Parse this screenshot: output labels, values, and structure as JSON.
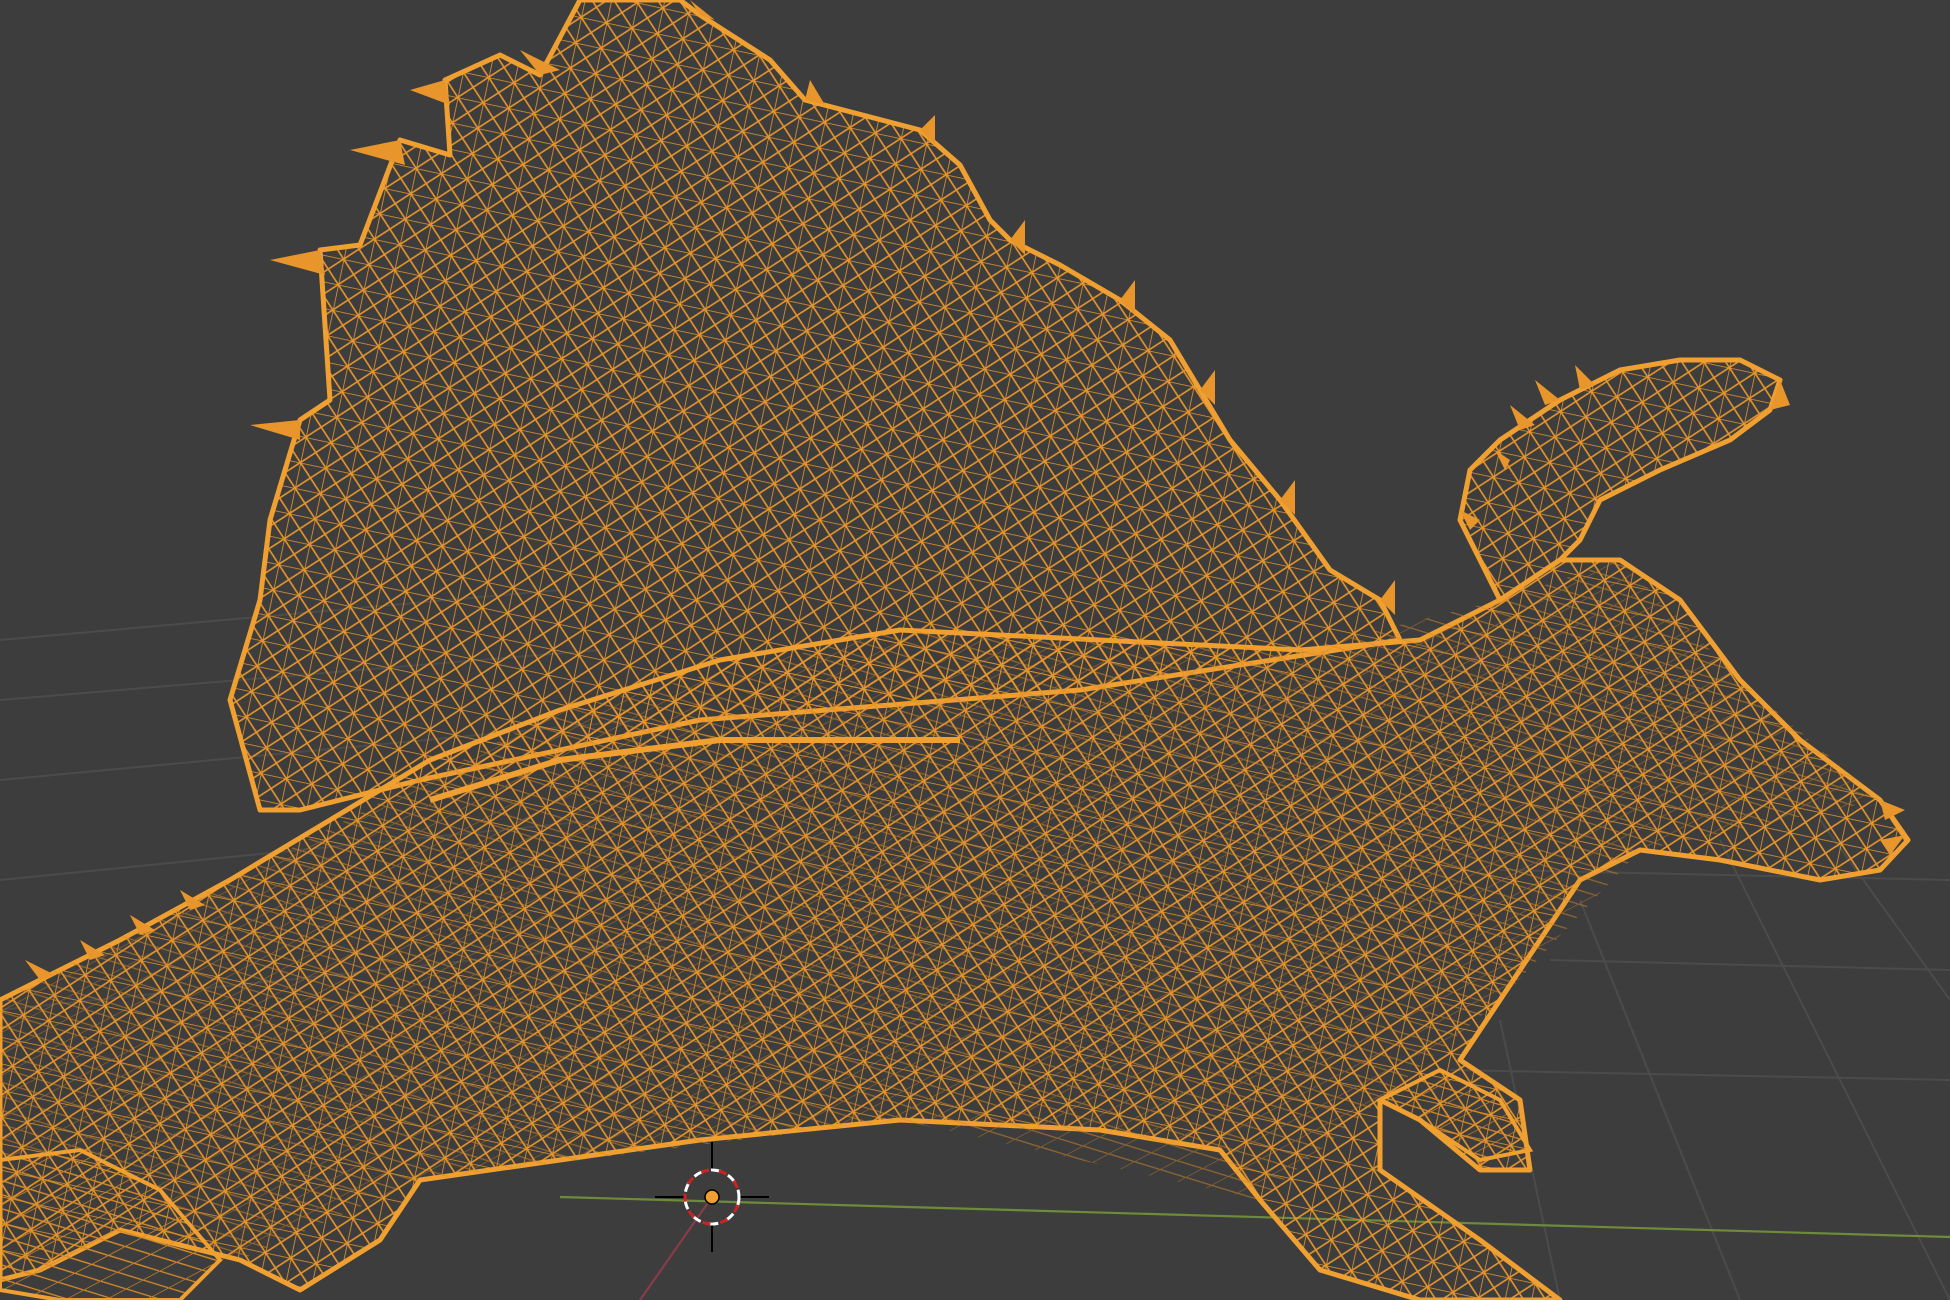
{
  "viewport": {
    "background": "#3d3d3d",
    "grid_color": "#4a4a4a",
    "x_axis_color": "#6e8b3a",
    "y_axis_color": "#8a3b4a",
    "selection_color": "#f0a030",
    "wire_color": "#e8962c",
    "mode": "wireframe",
    "selected_object": "dimetrodon-mesh"
  },
  "cursor": {
    "icon": "3d-cursor-icon",
    "ring_color_a": "#ffffff",
    "ring_color_b": "#d02020"
  },
  "origin": {
    "icon": "object-origin-dot",
    "color": "#f0a030"
  }
}
